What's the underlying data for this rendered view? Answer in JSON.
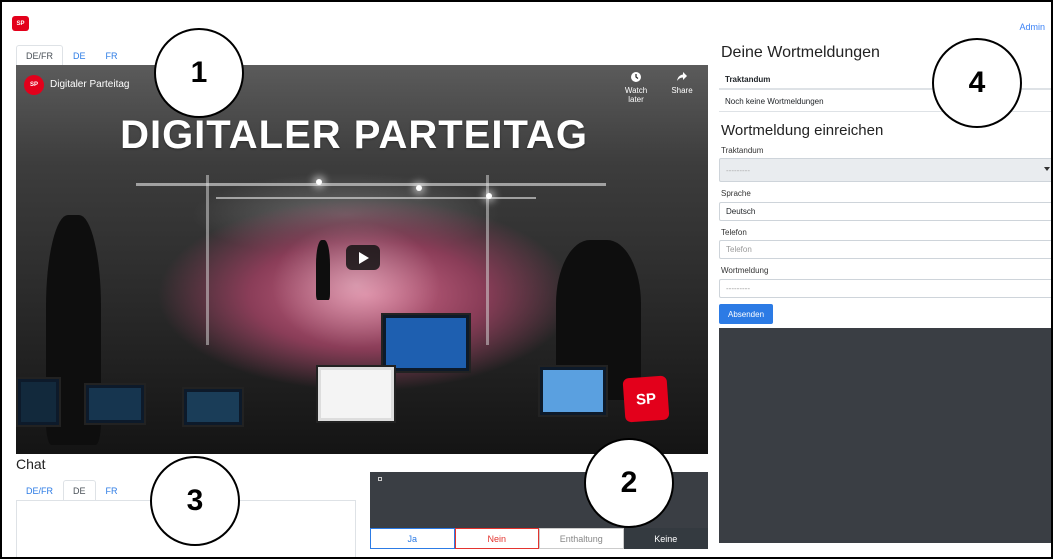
{
  "app": {
    "logo_text": "SP",
    "admin_label": "Admin"
  },
  "video": {
    "tabs": [
      {
        "label": "DE/FR",
        "active": true
      },
      {
        "label": "DE",
        "active": false
      },
      {
        "label": "FR",
        "active": false
      }
    ],
    "channel_avatar": "SP",
    "channel_title": "Digitaler Parteitag",
    "watch_later": "Watch later",
    "share": "Share",
    "heading": "DIGITALER PARTEITAG",
    "badge": "SP"
  },
  "chat": {
    "title": "Chat",
    "tabs": [
      {
        "label": "DE/FR",
        "active": false
      },
      {
        "label": "DE",
        "active": true
      },
      {
        "label": "FR",
        "active": false
      }
    ]
  },
  "vote": {
    "buttons": {
      "ja": "Ja",
      "nein": "Nein",
      "enthaltung": "Enthaltung",
      "keine": "Keine"
    }
  },
  "right": {
    "title": "Deine Wortmeldungen",
    "table_header": "Traktandum",
    "empty_row": "Noch keine Wortmeldungen",
    "form_title": "Wortmeldung einreichen",
    "fields": {
      "traktandum": {
        "label": "Traktandum",
        "value": "---------"
      },
      "sprache": {
        "label": "Sprache",
        "value": "Deutsch"
      },
      "telefon": {
        "label": "Telefon",
        "placeholder": "Telefon"
      },
      "wortmeldung": {
        "label": "Wortmeldung",
        "value": "---------"
      }
    },
    "submit": "Absenden"
  },
  "callouts": [
    "1",
    "2",
    "3",
    "4"
  ],
  "colors": {
    "brand": "#e3001b",
    "primary": "#2c7be5",
    "dark_panel": "#3a3e44"
  }
}
